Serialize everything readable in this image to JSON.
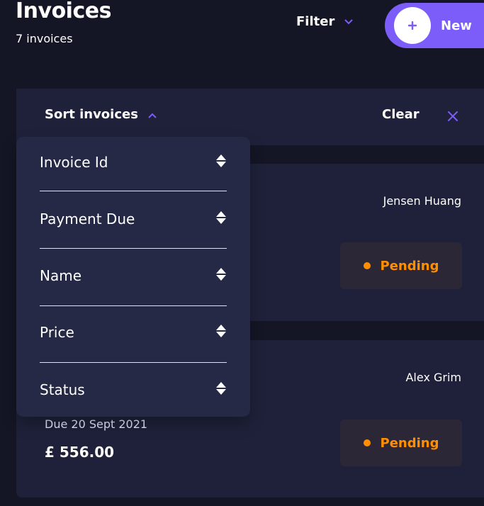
{
  "header": {
    "title": "Invoices",
    "count_text": "7 invoices",
    "filter_label": "Filter",
    "new_label": "New"
  },
  "sort_panel": {
    "title": "Sort invoices",
    "clear_label": "Clear",
    "options": [
      {
        "label": "Invoice Id"
      },
      {
        "label": "Payment Due"
      },
      {
        "label": "Name"
      },
      {
        "label": "Price"
      },
      {
        "label": "Status"
      }
    ]
  },
  "invoices": [
    {
      "client": "Jensen Huang",
      "status": "Pending"
    },
    {
      "client": "Alex Grim",
      "due": "Due 20 Sept 2021",
      "amount": "£ 556.00",
      "status": "Pending"
    }
  ],
  "colors": {
    "background": "#141625",
    "panel": "#1e2139",
    "dropdown": "#252945",
    "accent": "#7c5dfa",
    "pending": "#ff8f00"
  },
  "icons": [
    "chevron-down-icon",
    "plus-icon",
    "chevron-up-icon",
    "close-icon",
    "sort-arrows-icon",
    "status-dot-icon"
  ]
}
